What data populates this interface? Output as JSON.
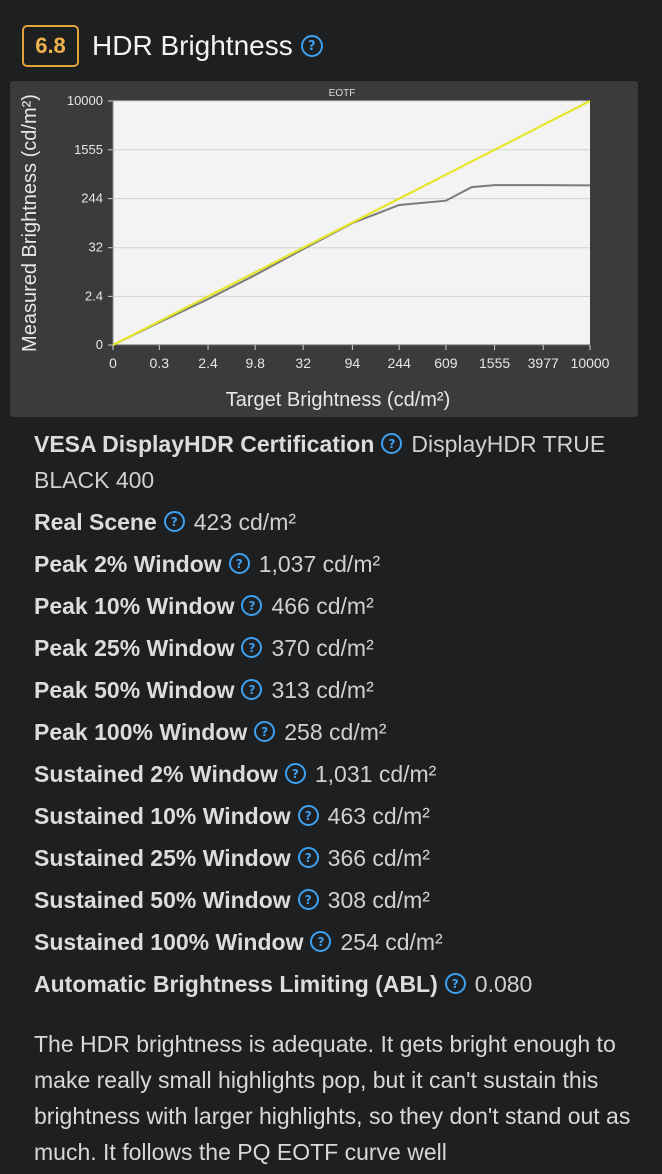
{
  "header": {
    "score": "6.8",
    "title": "HDR Brightness"
  },
  "chart_data": {
    "type": "line",
    "title": "EOTF",
    "xlabel": "Target Brightness (cd/m²)",
    "ylabel": "Measured Brightness (cd/m²)",
    "x_ticks": [
      "0",
      "0.3",
      "2.4",
      "9.8",
      "32",
      "94",
      "244",
      "609",
      "1555",
      "3977",
      "10000"
    ],
    "y_ticks": [
      "0",
      "2.4",
      "32",
      "244",
      "1555",
      "10000"
    ],
    "scale": "log (PQ)",
    "grid": "horizontal",
    "series": [
      {
        "role": "target",
        "color": "#e6e62a",
        "points": [
          [
            0,
            0
          ],
          [
            0.3,
            0.3
          ],
          [
            2.4,
            2.4
          ],
          [
            9.8,
            9.8
          ],
          [
            32,
            32
          ],
          [
            94,
            94
          ],
          [
            244,
            244
          ],
          [
            609,
            609
          ],
          [
            1555,
            1555
          ],
          [
            3977,
            3977
          ],
          [
            10000,
            10000
          ]
        ]
      },
      {
        "role": "measured",
        "color": "#7a7a7a",
        "points": [
          [
            0,
            0
          ],
          [
            0.3,
            0.27
          ],
          [
            2.4,
            2.0
          ],
          [
            9.8,
            8.5
          ],
          [
            32,
            30
          ],
          [
            94,
            92
          ],
          [
            244,
            190
          ],
          [
            609,
            225
          ],
          [
            1000,
            380
          ],
          [
            1555,
            410
          ],
          [
            3977,
            410
          ],
          [
            10000,
            405
          ]
        ]
      }
    ]
  },
  "specs": [
    {
      "label": "VESA DisplayHDR Certification",
      "value": "DisplayHDR TRUE BLACK 400"
    },
    {
      "label": "Real Scene",
      "value": "423 cd/m²"
    },
    {
      "label": "Peak 2% Window",
      "value": "1,037 cd/m²"
    },
    {
      "label": "Peak 10% Window",
      "value": "466 cd/m²"
    },
    {
      "label": "Peak 25% Window",
      "value": "370 cd/m²"
    },
    {
      "label": "Peak 50% Window",
      "value": "313 cd/m²"
    },
    {
      "label": "Peak 100% Window",
      "value": "258 cd/m²"
    },
    {
      "label": "Sustained 2% Window",
      "value": "1,031 cd/m²"
    },
    {
      "label": "Sustained 10% Window",
      "value": "463 cd/m²"
    },
    {
      "label": "Sustained 25% Window",
      "value": "366 cd/m²"
    },
    {
      "label": "Sustained 50% Window",
      "value": "308 cd/m²"
    },
    {
      "label": "Sustained 100% Window",
      "value": "254 cd/m²"
    },
    {
      "label": "Automatic Brightness Limiting (ABL)",
      "value": "0.080"
    }
  ],
  "description": "The HDR brightness is adequate. It gets bright enough to make really small highlights pop, but it can't sustain this brightness with larger highlights, so they don't stand out as much. It follows the PQ EOTF curve well"
}
